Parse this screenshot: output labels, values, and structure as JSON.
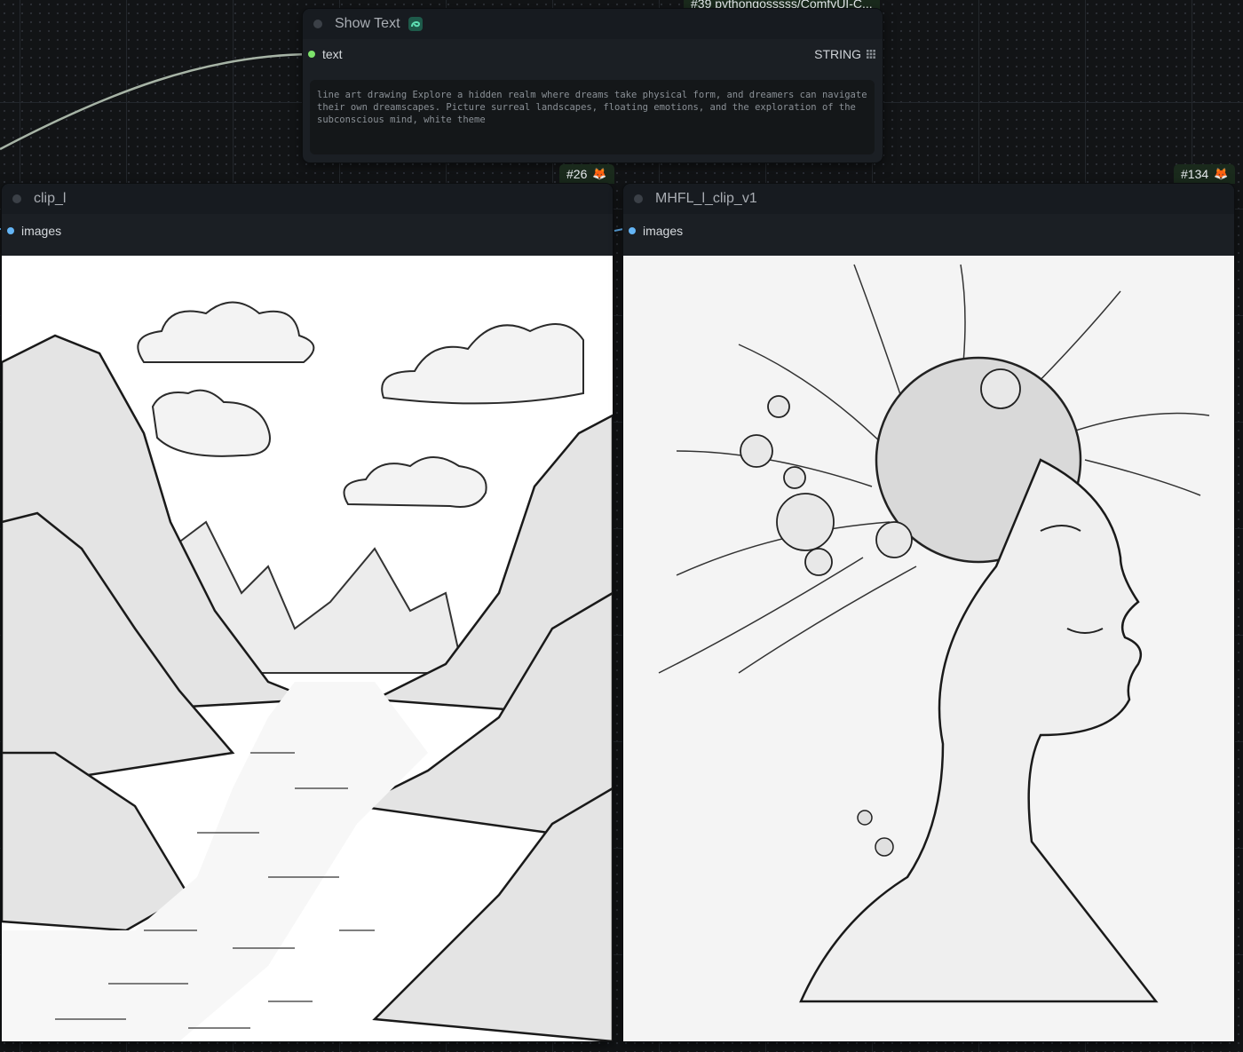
{
  "top_badge": {
    "label": "#39 pythongosssss/ComfyUI-C..."
  },
  "show_text_node": {
    "title": "Show Text",
    "title_icon": "snake-icon",
    "input_label": "text",
    "output_type": "STRING",
    "output_icon": "grid-icon",
    "text_value": "line art drawing Explore a hidden realm where dreams take physical form, and dreamers can navigate their own dreamscapes. Picture surreal landscapes, floating emotions, and the exploration of the subconscious mind, white theme"
  },
  "clip_l_node": {
    "badge": "#26",
    "badge_icon": "fox-icon",
    "title": "clip_l",
    "input_label": "images",
    "image_subject": "line art mountain valley with river"
  },
  "mhfl_node": {
    "badge": "#134",
    "badge_icon": "fox-icon",
    "title": "MHFL_l_clip_v1",
    "input_label": "images",
    "image_subject": "pencil sketch woman profile with sphere headdress"
  },
  "colors": {
    "canvas_bg": "#121416",
    "node_bg": "#1b1f24",
    "string_slot": "#7de26b",
    "image_slot": "#64b5f6",
    "wire": "#a7b4a6"
  }
}
